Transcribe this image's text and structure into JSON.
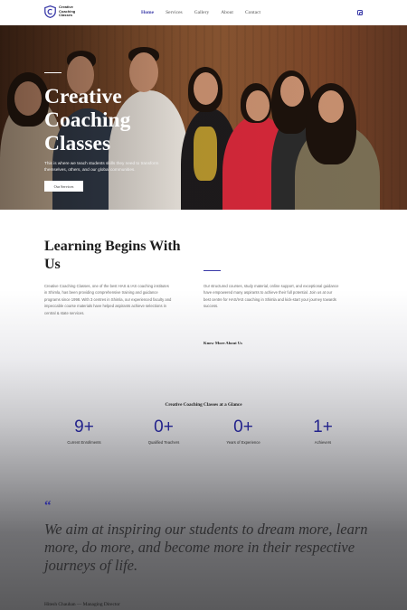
{
  "header": {
    "logo_lines": [
      "Creative",
      "Coaching",
      "Classes"
    ],
    "nav": [
      {
        "label": "Home",
        "active": true
      },
      {
        "label": "Services",
        "active": false
      },
      {
        "label": "Gallery",
        "active": false
      },
      {
        "label": "About",
        "active": false
      },
      {
        "label": "Contact",
        "active": false
      }
    ],
    "social_icon": "instagram-icon"
  },
  "hero": {
    "title": "Creative Coaching Classes",
    "subtitle": "This is where we teach students skills they need to transform themselves, others, and our global communities.",
    "button_label": "Our Services"
  },
  "learning": {
    "title": "Learning Begins With Us",
    "left_paragraph": "Creative Coaching Classes, one of the best HAS & IAS coaching institutes in Shimla, has been providing comprehensive training and guidance programs since 1998. With 3 centres in Shimla, our experienced faculty and impeccable course materials have helped aspirants achieve selections in central & state services.",
    "right_paragraph": "Our structured courses, study material, online support, and exceptional guidance have empowered many aspirants to achieve their full potential. Join us at our best centre for HAS/IAS coaching in Shimla and kick-start your journey towards success.",
    "link_label": "Know More About Us"
  },
  "glance": {
    "title": "Creative Coaching Classes at a Glance",
    "stats": [
      {
        "value": "9+",
        "label": "Current Enrollments"
      },
      {
        "value": "0+",
        "label": "Qualified Teachers"
      },
      {
        "value": "0+",
        "label": "Years of Experience"
      },
      {
        "value": "1+",
        "label": "Achievers"
      }
    ]
  },
  "testimonial": {
    "quote_mark": "“",
    "quote": "We aim at inspiring our students to dream more, learn more, do more, and become more in their respective journeys of life.",
    "author": "Hitesh Chauhan — Managing Director"
  },
  "colors": {
    "accent": "#3a3aa8",
    "stat_number": "#23238c"
  }
}
